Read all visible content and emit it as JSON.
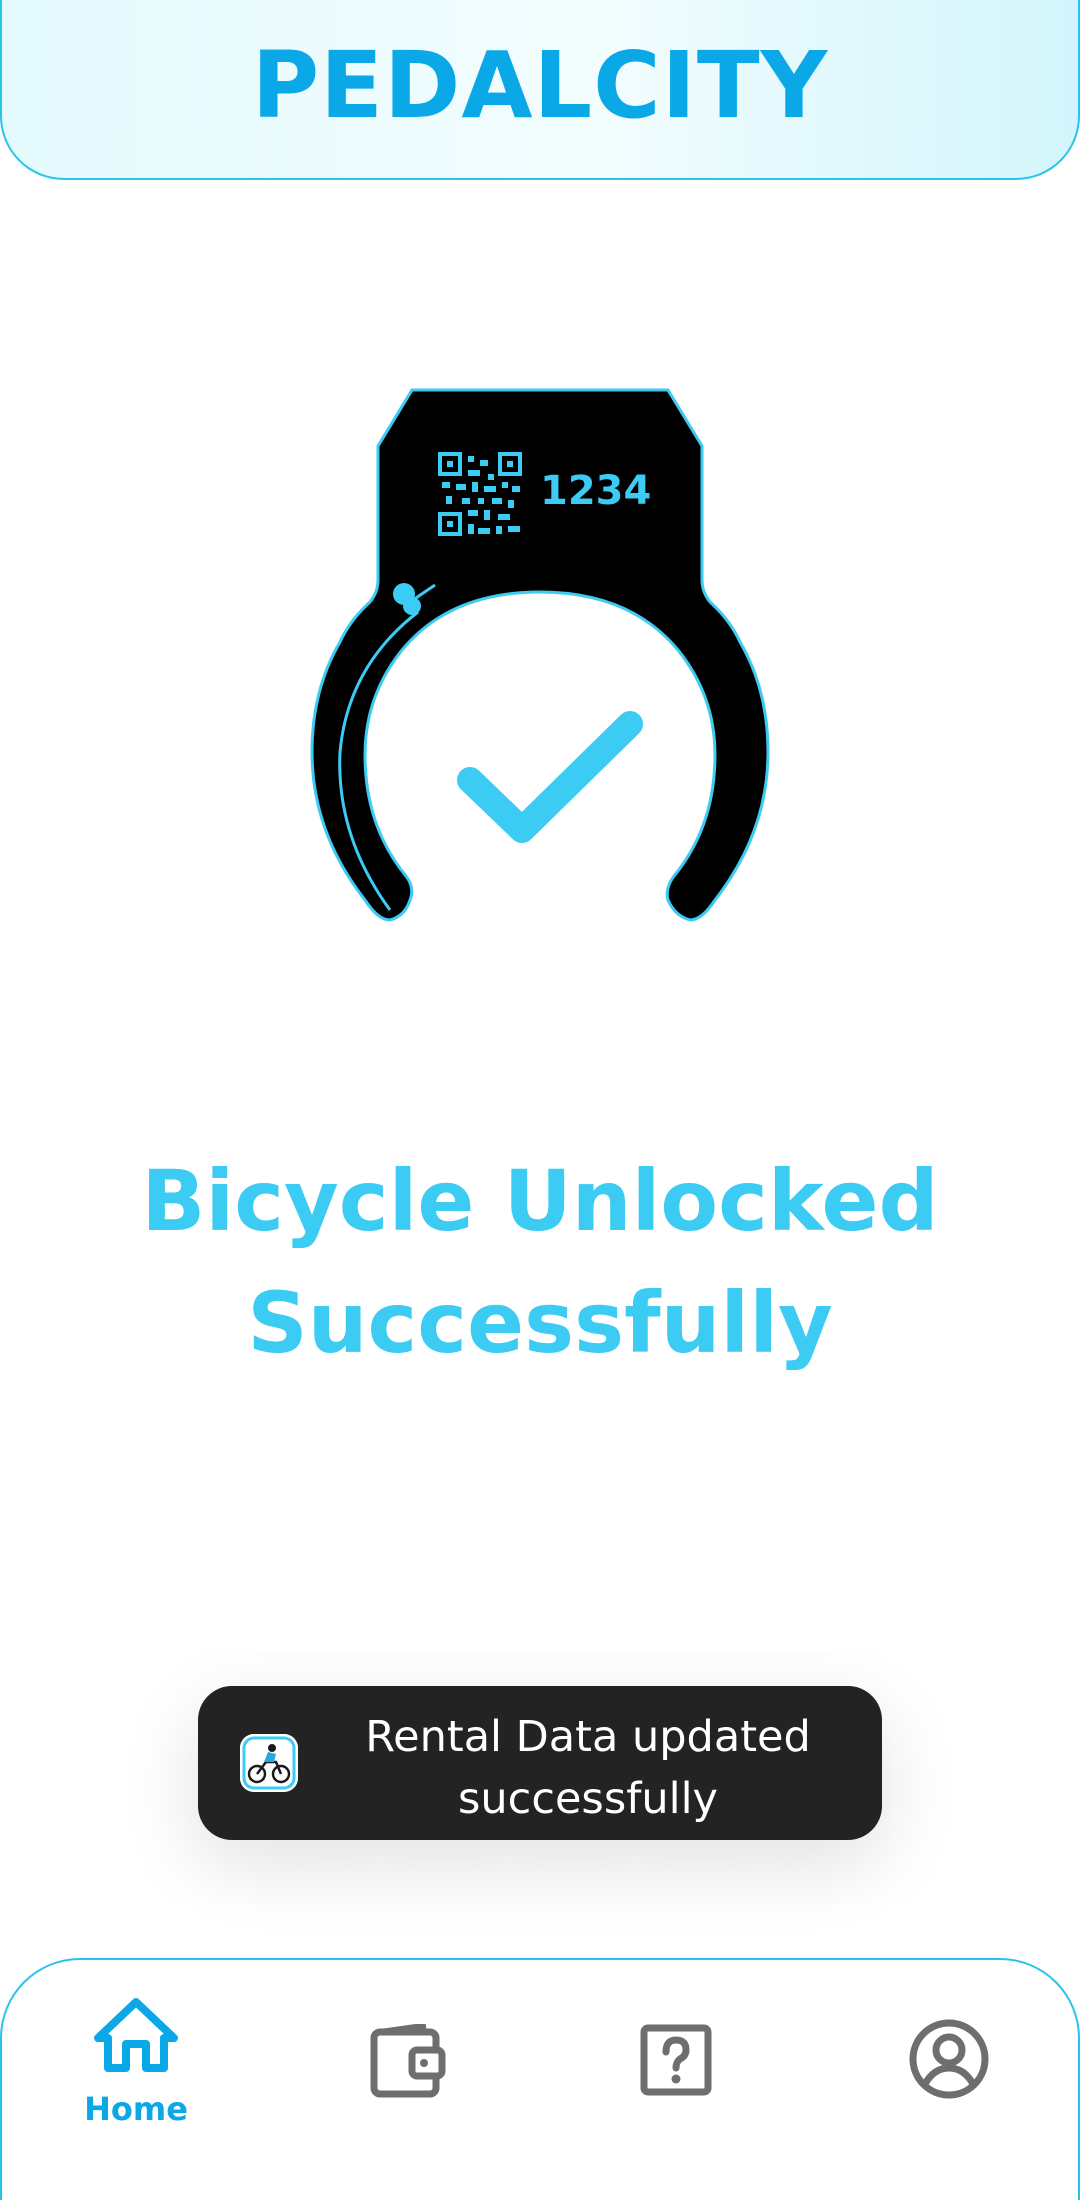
{
  "header": {
    "brand": "PEDALCITY"
  },
  "illustration": {
    "lock_code": "1234",
    "icons": [
      "qr-code-icon",
      "checkmark-icon"
    ]
  },
  "status": {
    "line1": "Bicycle Unlocked",
    "line2": "Successfully"
  },
  "toast": {
    "icon": "cyclist-icon",
    "line1": "Rental Data updated",
    "line2": "successfully"
  },
  "bottom_nav": {
    "items": [
      {
        "label": "Home",
        "icon": "home-icon",
        "active": true
      },
      {
        "icon": "wallet-icon",
        "active": false
      },
      {
        "icon": "help-icon",
        "active": false
      },
      {
        "icon": "profile-icon",
        "active": false
      }
    ]
  },
  "colors": {
    "brand": "#0BA8E8",
    "accent": "#3CCBF3",
    "toast_bg": "#232323",
    "nav_inactive": "#6E6E6E"
  }
}
